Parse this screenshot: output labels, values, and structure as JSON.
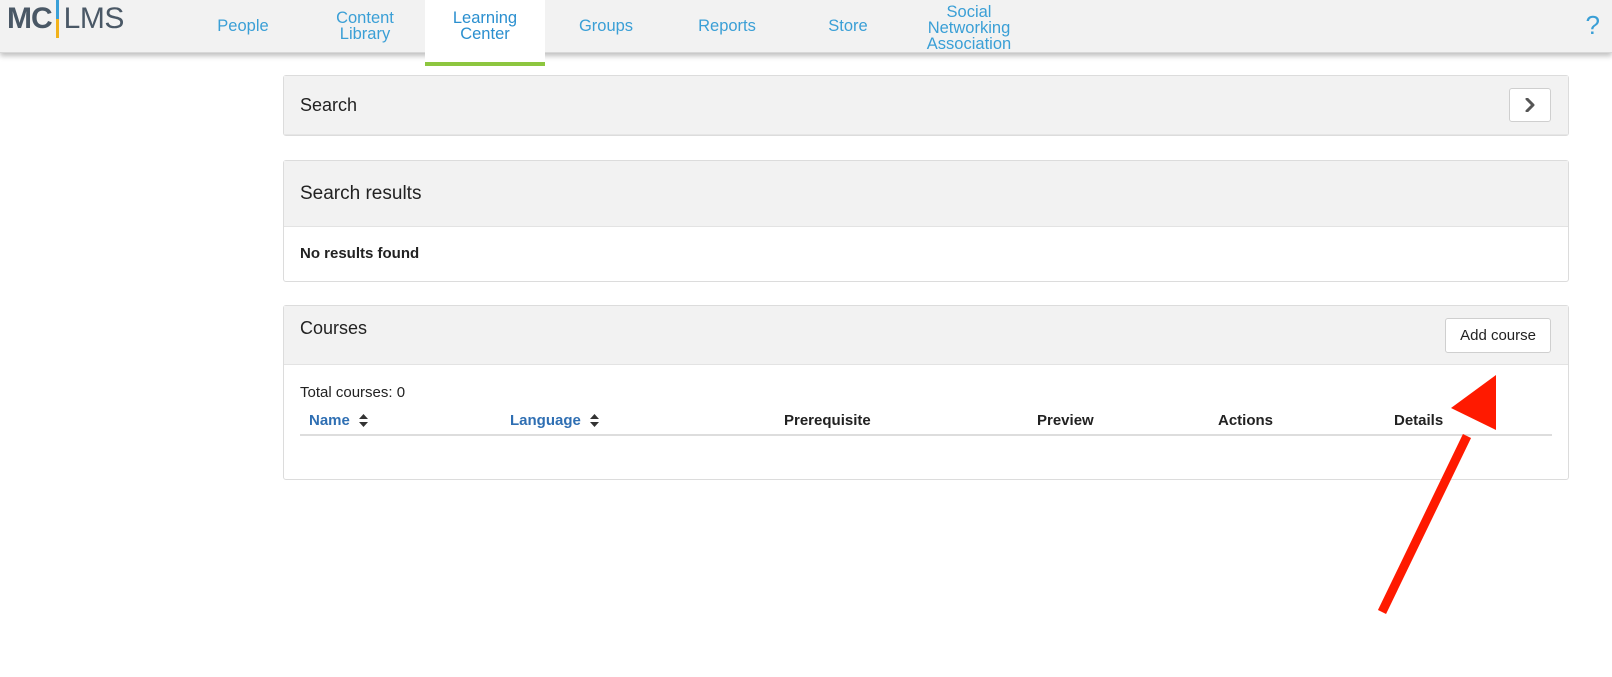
{
  "logo": {
    "mc": "MC",
    "lms": "LMS"
  },
  "nav": {
    "tabs": [
      {
        "label": "People",
        "active": false
      },
      {
        "label": "Content\nLibrary",
        "active": false
      },
      {
        "label": "Learning\nCenter",
        "active": true
      },
      {
        "label": "Groups",
        "active": false
      },
      {
        "label": "Reports",
        "active": false
      },
      {
        "label": "Store",
        "active": false
      },
      {
        "label": "Social\nNetworking\nAssociation",
        "active": false
      }
    ],
    "help": "?"
  },
  "search": {
    "title": "Search",
    "expand_icon": "chevron-right-icon"
  },
  "results": {
    "title": "Search results",
    "empty_text": "No results found"
  },
  "courses": {
    "title": "Courses",
    "add_label": "Add course",
    "total": "Total courses: 0",
    "columns": [
      {
        "label": "Name",
        "sortable": true
      },
      {
        "label": "Language",
        "sortable": true
      },
      {
        "label": "Prerequisite",
        "sortable": false
      },
      {
        "label": "Preview",
        "sortable": false
      },
      {
        "label": "Actions",
        "sortable": false
      },
      {
        "label": "Details",
        "sortable": false
      }
    ]
  },
  "colors": {
    "link": "#3a9fd6",
    "active_underline": "#8dc63f",
    "annotation_arrow": "#ff1a00"
  }
}
